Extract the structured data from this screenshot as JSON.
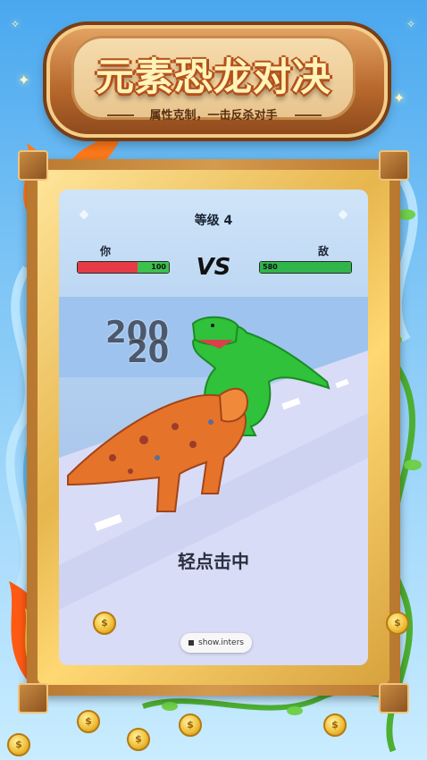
{
  "banner": {
    "title": "元素恐龙对决",
    "subtitle": "属性克制，一击反杀对手"
  },
  "game": {
    "level_label": "等级 4",
    "player_label": "你",
    "enemy_label": "敌",
    "vs_label": "VS",
    "player_hp": {
      "value": "100",
      "fill_fraction": 0.66,
      "fill_color": "#e53b45",
      "rest_color": "#3cc04e"
    },
    "enemy_hp": {
      "value": "580",
      "fill_fraction": 1.0,
      "fill_color": "#2fb54a"
    },
    "damage_numbers": [
      "200",
      "20"
    ],
    "tap_prompt": "轻点击中",
    "ad_button_label": "show.inters"
  },
  "colors": {
    "player_dino": "#e5742a",
    "enemy_dino": "#2fc23a",
    "frame_wood": "#b9782f",
    "frame_gold": "#e7b64e"
  },
  "icons": [
    "fire-icon",
    "water-icon",
    "vine-icon",
    "coin-icon",
    "gem-icon",
    "sparkle-icon"
  ]
}
